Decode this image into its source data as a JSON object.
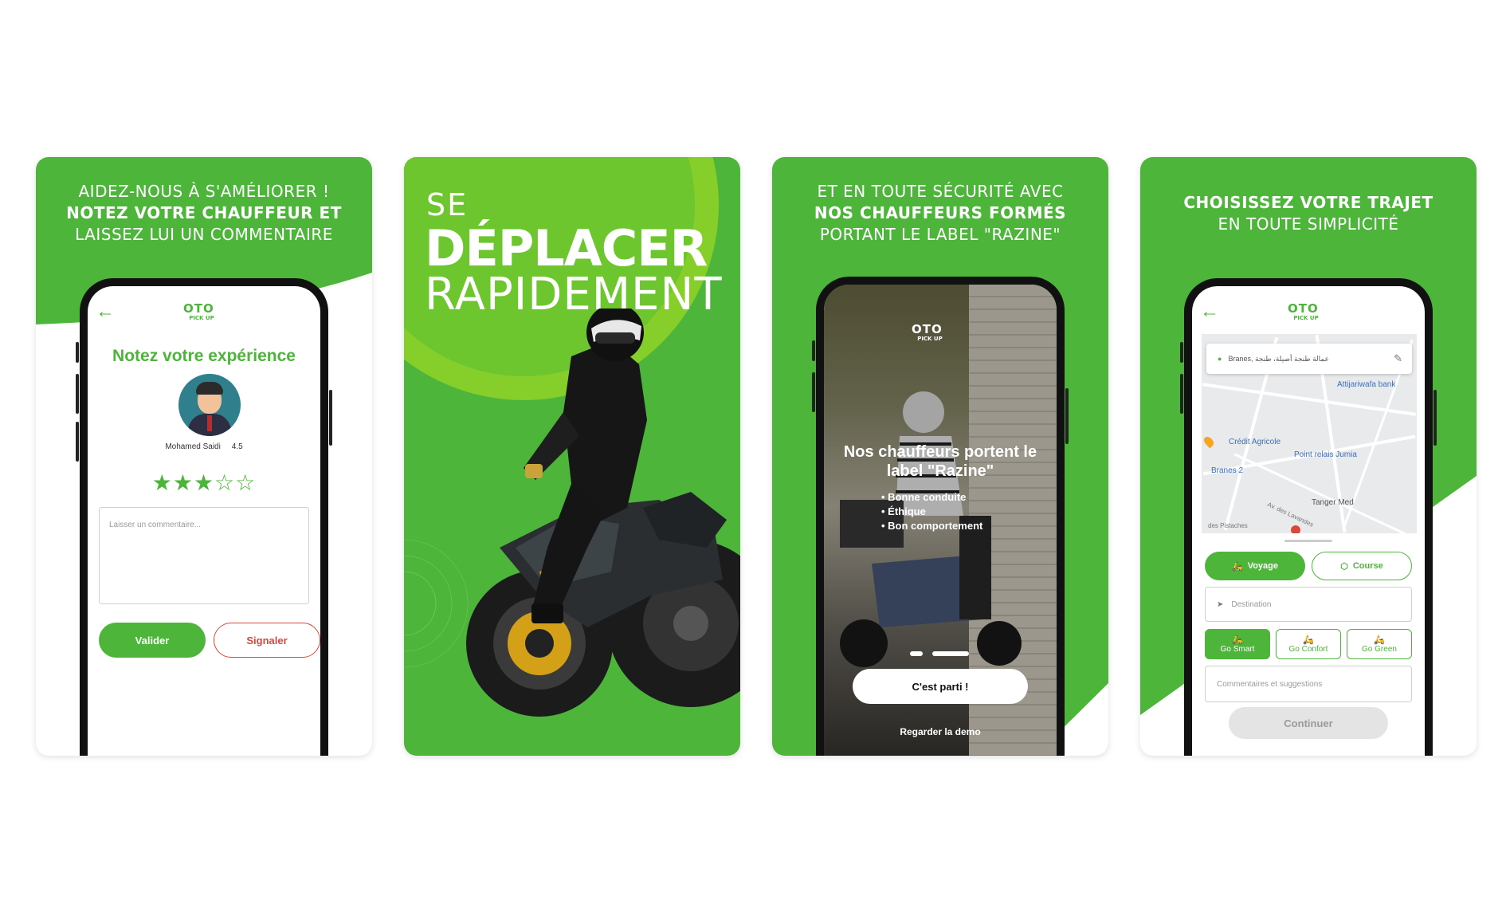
{
  "colors": {
    "brand_green": "#4cb53a",
    "lime": "#8fd11f",
    "red_outline": "#d9473b",
    "dark": "#111111"
  },
  "card1": {
    "headline": {
      "line1": "AIDEZ-NOUS À S'AMÉLIORER !",
      "line2": "NOTEZ VOTRE CHAUFFEUR ET",
      "line3": "LAISSEZ  LUI UN COMMENTAIRE"
    },
    "logo": {
      "top": "OTO",
      "sub": "PICK UP"
    },
    "title": "Notez votre expérience",
    "driver": {
      "name": "Mohamed Saidi",
      "rating": "4.5"
    },
    "stars": {
      "filled": 3,
      "total": 5
    },
    "comment_placeholder": "Laisser un commentaire...",
    "validate_label": "Valider",
    "report_label": "Signaler"
  },
  "card2": {
    "line1": "SE",
    "line2": "DÉPLACER",
    "line3": "RAPIDEMENT"
  },
  "card3": {
    "headline": {
      "line1": "ET EN TOUTE SÉCURITÉ AVEC",
      "line2": "NOS CHAUFFEURS FORMÉS",
      "line3": "PORTANT LE LABEL \"RAZINE\""
    },
    "logo": {
      "top": "OTO",
      "sub": "PICK UP"
    },
    "slide_title_1": "Nos chauffeurs portent le",
    "slide_title_2": "label \"Razine\"",
    "bullets": [
      "Bonne conduite",
      "Éthique",
      "Bon comportement"
    ],
    "start_label": "C'est parti !",
    "demo_label": "Regarder la demo"
  },
  "card4": {
    "headline": {
      "line1": "CHOISISSEZ VOTRE TRAJET",
      "line2": "EN TOUTE SIMPLICITÉ"
    },
    "logo": {
      "top": "OTO",
      "sub": "PICK UP"
    },
    "location_text": "Branes, عمالة طنجة أصيلة، طنجة",
    "map_labels": {
      "bank": "Attijariwafa bank",
      "agricole": "Crédit Agricole",
      "jumia": "Point relais Jumia",
      "branes2": "Branes 2",
      "tangermed": "Tanger Med",
      "lavandes": "Av. des Lavandes",
      "pistaches": "des Pistaches"
    },
    "tabs": {
      "voyage": "Voyage",
      "course": "Course"
    },
    "destination_placeholder": "Destination",
    "services": [
      "Go Smart",
      "Go Confort",
      "Go Green"
    ],
    "comments_placeholder": "Commentaires et suggestions",
    "continue_label": "Continuer"
  }
}
